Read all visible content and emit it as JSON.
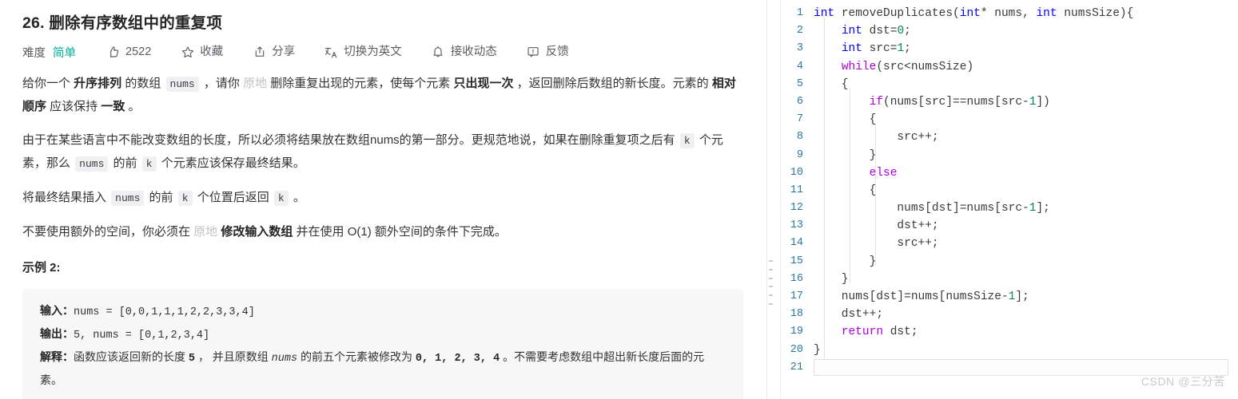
{
  "problem": {
    "title": "26. 删除有序数组中的重复项",
    "meta": {
      "difficulty_label": "难度",
      "difficulty_value": "简单",
      "difficulty_color": "#00af9b",
      "likes_count": "2522",
      "favorite_label": "收藏",
      "share_label": "分享",
      "translate_label": "切换为英文",
      "subscribe_label": "接收动态",
      "feedback_label": "反馈"
    },
    "paragraph1": {
      "s1": "给你一个 ",
      "b1": "升序排列",
      "s2": " 的数组 ",
      "c1": "nums",
      "s3": " ，请你 ",
      "d1": "原地",
      "s4": " 删除重复出现的元素，使每个元素 ",
      "b2": "只出现一次",
      "s5": " ，返回删除后数组的新长度。元素的 ",
      "b3": "相对顺序",
      "s6": " 应该保持 ",
      "b4": "一致",
      "s7": " 。"
    },
    "paragraph2": {
      "s1": "由于在某些语言中不能改变数组的长度，所以必须将结果放在数组nums的第一部分。更规范地说，如果在删除重复项之后有 ",
      "c1": "k",
      "s2": " 个元素，那么 ",
      "c2": "nums",
      "s3": " 的前 ",
      "c3": "k",
      "s4": " 个元素应该保存最终结果。"
    },
    "paragraph3": {
      "s1": "将最终结果插入 ",
      "c1": "nums",
      "s2": " 的前 ",
      "c2": "k",
      "s3": " 个位置后返回 ",
      "c3": "k",
      "s4": " 。"
    },
    "paragraph4": {
      "s1": "不要使用额外的空间，你必须在 ",
      "d1": "原地",
      "s2": " ",
      "b1": "修改输入数组",
      "s3": " 并在使用 O(1) 额外空间的条件下完成。"
    },
    "example": {
      "heading": "示例 2:",
      "input_key": "输入：",
      "input_value": "nums = [0,0,1,1,1,2,2,3,3,4]",
      "output_key": "输出：",
      "output_value": "5, nums = [0,1,2,3,4]",
      "explain_key": "解释：",
      "explain_p1": "函数应该返回新的长度 ",
      "explain_v1": "5",
      "explain_p2": " ， 并且原数组 ",
      "explain_v2": "nums",
      "explain_p3": " 的前五个元素被修改为 ",
      "explain_v3": "0, 1, 2, 3, 4",
      "explain_p4": " 。不需要考虑数组中超出新长度后面的元素。"
    }
  },
  "editor": {
    "lines": [
      {
        "n": "1",
        "tokens": [
          {
            "t": "int",
            "c": "t-kw"
          },
          {
            "t": " ",
            "c": "t-punct"
          },
          {
            "t": "removeDuplicates",
            "c": "t-fn"
          },
          {
            "t": "(",
            "c": "t-punct"
          },
          {
            "t": "int",
            "c": "t-kw"
          },
          {
            "t": "* nums, ",
            "c": "t-punct"
          },
          {
            "t": "int",
            "c": "t-kw"
          },
          {
            "t": " numsSize){",
            "c": "t-punct"
          }
        ]
      },
      {
        "n": "2",
        "tokens": [
          {
            "t": "    ",
            "c": "t-punct"
          },
          {
            "t": "int",
            "c": "t-kw"
          },
          {
            "t": " dst=",
            "c": "t-punct"
          },
          {
            "t": "0",
            "c": "t-num"
          },
          {
            "t": ";",
            "c": "t-punct"
          }
        ]
      },
      {
        "n": "3",
        "tokens": [
          {
            "t": "    ",
            "c": "t-punct"
          },
          {
            "t": "int",
            "c": "t-kw"
          },
          {
            "t": " src=",
            "c": "t-punct"
          },
          {
            "t": "1",
            "c": "t-num"
          },
          {
            "t": ";",
            "c": "t-punct"
          }
        ]
      },
      {
        "n": "4",
        "tokens": [
          {
            "t": "    ",
            "c": "t-punct"
          },
          {
            "t": "while",
            "c": "t-ctl"
          },
          {
            "t": "(src<numsSize)",
            "c": "t-punct"
          }
        ]
      },
      {
        "n": "5",
        "tokens": [
          {
            "t": "    {",
            "c": "t-punct"
          }
        ]
      },
      {
        "n": "6",
        "tokens": [
          {
            "t": "        ",
            "c": "t-punct"
          },
          {
            "t": "if",
            "c": "t-ctl"
          },
          {
            "t": "(nums[src]==nums[src-",
            "c": "t-punct"
          },
          {
            "t": "1",
            "c": "t-num"
          },
          {
            "t": "])",
            "c": "t-punct"
          }
        ]
      },
      {
        "n": "7",
        "tokens": [
          {
            "t": "        {",
            "c": "t-punct"
          }
        ]
      },
      {
        "n": "8",
        "tokens": [
          {
            "t": "            src++;",
            "c": "t-punct"
          }
        ]
      },
      {
        "n": "9",
        "tokens": [
          {
            "t": "        }",
            "c": "t-punct"
          }
        ]
      },
      {
        "n": "10",
        "tokens": [
          {
            "t": "        ",
            "c": "t-punct"
          },
          {
            "t": "else",
            "c": "t-ctl"
          }
        ]
      },
      {
        "n": "11",
        "tokens": [
          {
            "t": "        {",
            "c": "t-punct"
          }
        ]
      },
      {
        "n": "12",
        "tokens": [
          {
            "t": "            nums[dst]=nums[src-",
            "c": "t-punct"
          },
          {
            "t": "1",
            "c": "t-num"
          },
          {
            "t": "];",
            "c": "t-punct"
          }
        ]
      },
      {
        "n": "13",
        "tokens": [
          {
            "t": "            dst++;",
            "c": "t-punct"
          }
        ]
      },
      {
        "n": "14",
        "tokens": [
          {
            "t": "            src++;",
            "c": "t-punct"
          }
        ]
      },
      {
        "n": "15",
        "tokens": [
          {
            "t": "        }",
            "c": "t-punct"
          }
        ]
      },
      {
        "n": "16",
        "tokens": [
          {
            "t": "    }",
            "c": "t-punct"
          }
        ]
      },
      {
        "n": "17",
        "tokens": [
          {
            "t": "    nums[dst]=nums[numsSize-",
            "c": "t-punct"
          },
          {
            "t": "1",
            "c": "t-num"
          },
          {
            "t": "];",
            "c": "t-punct"
          }
        ]
      },
      {
        "n": "18",
        "tokens": [
          {
            "t": "    dst++;",
            "c": "t-punct"
          }
        ]
      },
      {
        "n": "19",
        "tokens": [
          {
            "t": "    ",
            "c": "t-punct"
          },
          {
            "t": "return",
            "c": "t-ctl"
          },
          {
            "t": " dst;",
            "c": "t-punct"
          }
        ]
      },
      {
        "n": "20",
        "tokens": [
          {
            "t": "}",
            "c": "t-punct"
          }
        ]
      },
      {
        "n": "21",
        "tokens": [],
        "active": true
      }
    ]
  },
  "watermark": "CSDN @三分苦"
}
